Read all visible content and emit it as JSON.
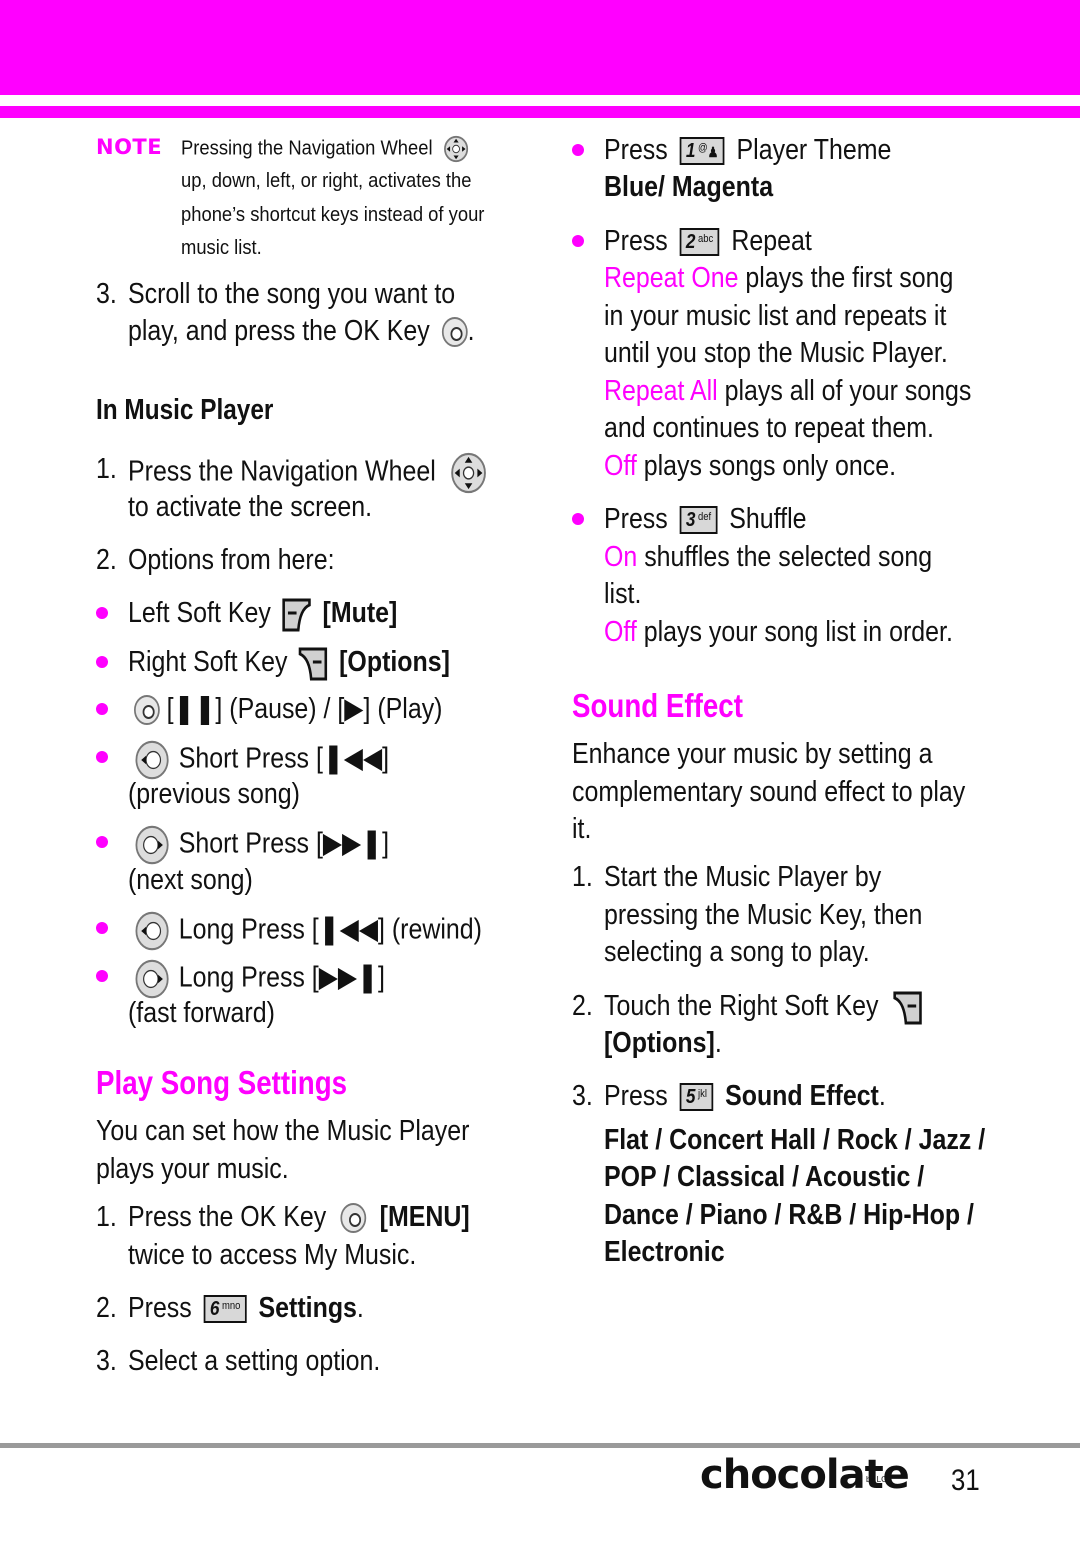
{
  "brand_color": "#ff00ff",
  "note": {
    "tag": "NOTE",
    "lines": [
      "Pressing the Navigation Wheel",
      "up, down, left, or right, activates the",
      "phone’s shortcut keys instead of your",
      "music list."
    ]
  },
  "left": {
    "step3": {
      "num": "3.",
      "line1": "Scroll to the song you want to",
      "line2": "play, and press the OK Key",
      "line2_end": "."
    },
    "music_player_heading": "In Music Player",
    "mp_step1": {
      "num": "1.",
      "line1": "Press the Navigation Wheel",
      "line2": "to activate the screen."
    },
    "mp_step2": {
      "num": "2.",
      "text": "Options from here:"
    },
    "options": [
      {
        "text": "Left Soft Key",
        "bold": "[Mute]",
        "icon": "left-soft-key-icon"
      },
      {
        "text": "Right Soft Key",
        "bold": "[Options]",
        "icon": "right-soft-key-icon"
      },
      {
        "text": "[❚❚] (Pause) / [▶] (Play)",
        "icon": "ok-key-icon"
      },
      {
        "text": "Short Press [❚◀◀]",
        "line2": "(previous song)",
        "icon": "nav-left-icon"
      },
      {
        "text": "Short Press [▶▶❚]",
        "line2": "(next song)",
        "icon": "nav-right-icon"
      },
      {
        "text": "Long Press [❚◀◀] (rewind)",
        "icon": "nav-left-icon"
      },
      {
        "text": "Long Press [▶▶❚]",
        "line2": "(fast forward)",
        "icon": "nav-right-icon"
      }
    ],
    "play_song_settings": {
      "heading": "Play Song Settings",
      "intro1": "You can set how the Music Player",
      "intro2": "plays your music.",
      "step1": {
        "num": "1.",
        "line1": "Press the OK Key",
        "bold": "[MENU]",
        "line2": "twice to access My Music."
      },
      "step2": {
        "num": "2.",
        "text": "Press",
        "key": "6",
        "key_sub": "mno",
        "bold": "Settings",
        "end": "."
      },
      "step3": {
        "num": "3.",
        "text": "Select a setting option."
      }
    }
  },
  "right": {
    "theme": {
      "text": "Press",
      "key": "1",
      "key_sub": "@",
      "label": "Player Theme",
      "values": "Blue/ Magenta"
    },
    "repeat": {
      "text": "Press",
      "key": "2",
      "key_sub": "abc",
      "label": "Repeat",
      "one_label": "Repeat One",
      "one_desc1": "plays the first song",
      "one_desc2": "in your music list and repeats it",
      "one_desc3": "until you stop the Music Player.",
      "all_label": "Repeat All",
      "all_desc1": "plays all of your songs",
      "all_desc2": "and continues to repeat them.",
      "off_label": "Off",
      "off_desc": "plays songs only once."
    },
    "shuffle": {
      "text": "Press",
      "key": "3",
      "key_sub": "def",
      "label": "Shuffle",
      "on_label": "On",
      "on_desc1": "shuffles the selected song",
      "on_desc2": "list.",
      "off_label": "Off",
      "off_desc": "plays your song list in order."
    },
    "sound_effect": {
      "heading": "Sound Effect",
      "intro1": "Enhance your music by setting a",
      "intro2": "complementary sound effect to play",
      "intro3": "it.",
      "step1": {
        "num": "1.",
        "line1": "Start the Music Player by",
        "line2": "pressing the Music Key, then",
        "line3": "selecting a song to play."
      },
      "step2": {
        "num": "2.",
        "line1": "Touch the Right Soft Key",
        "bold": "[Options]",
        "end": "."
      },
      "step3": {
        "num": "3.",
        "text": "Press",
        "key": "5",
        "key_sub": "jkl",
        "bold": "Sound Effect",
        "end": "."
      },
      "options_lines": [
        "Flat / Concert Hall / Rock / Jazz /",
        "POP / Classical / Acoustic /",
        "Dance / Piano / R&B / Hip-Hop /",
        "Electronic"
      ]
    }
  },
  "footer": {
    "logo": "chocolate",
    "logo_sub": "by LG",
    "page_number": "31"
  }
}
